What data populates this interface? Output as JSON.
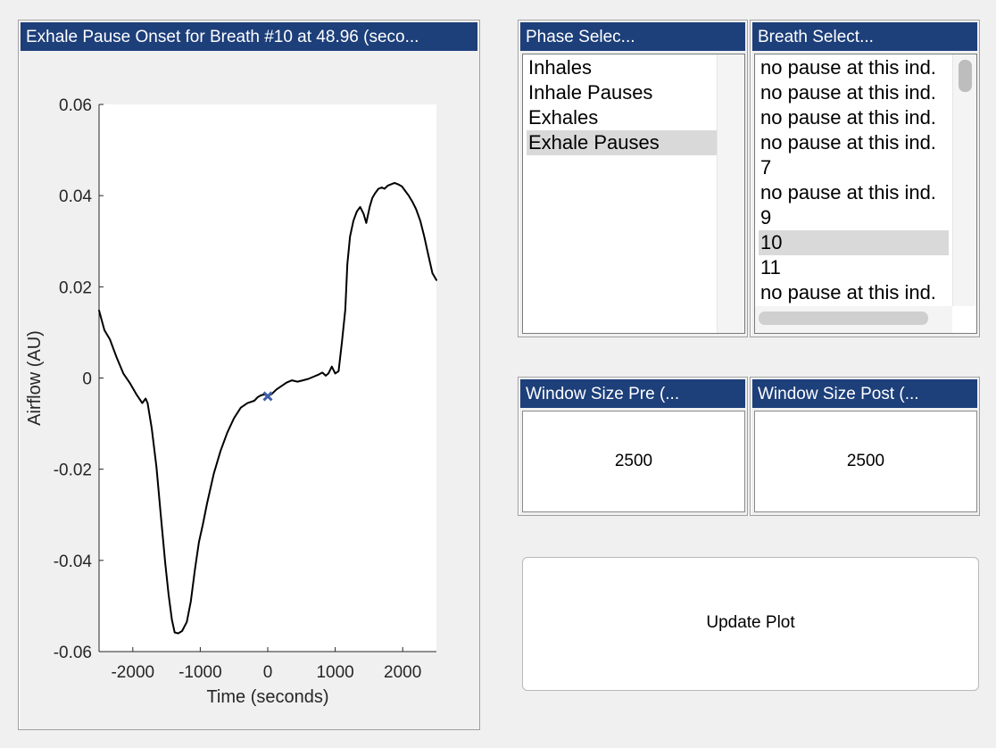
{
  "plot_panel": {
    "title": "Exhale Pause Onset for Breath #10 at 48.96 (seco..."
  },
  "phase_panel": {
    "title": "Phase Selec...",
    "items": [
      {
        "label": "Inhales",
        "selected": false
      },
      {
        "label": "Inhale Pauses",
        "selected": false
      },
      {
        "label": "Exhales",
        "selected": false
      },
      {
        "label": "Exhale Pauses",
        "selected": true
      }
    ]
  },
  "breath_panel": {
    "title": "Breath Select...",
    "items": [
      {
        "label": "no pause at this ind.",
        "selected": false
      },
      {
        "label": "no pause at this ind.",
        "selected": false
      },
      {
        "label": "no pause at this ind.",
        "selected": false
      },
      {
        "label": "no pause at this ind.",
        "selected": false
      },
      {
        "label": "7",
        "selected": false
      },
      {
        "label": "no pause at this ind.",
        "selected": false
      },
      {
        "label": "9",
        "selected": false
      },
      {
        "label": "10",
        "selected": true
      },
      {
        "label": "11",
        "selected": false
      },
      {
        "label": "no pause at this ind.",
        "selected": false
      }
    ]
  },
  "window_pre": {
    "title": "Window Size Pre (...",
    "value": "2500"
  },
  "window_post": {
    "title": "Window Size Post (...",
    "value": "2500"
  },
  "update_button": {
    "label": "Update Plot"
  },
  "colors": {
    "title_bar": "#1d3f7a",
    "selection": "#d9d9d9",
    "trace": "#000000",
    "marker": "#3f5fa8"
  },
  "chart_data": {
    "type": "line",
    "xlabel": "Time (seconds)",
    "ylabel": "Airflow (AU)",
    "xlim": [
      -2500,
      2500
    ],
    "ylim": [
      -0.06,
      0.06
    ],
    "xticks": [
      -2000,
      -1000,
      0,
      1000,
      2000
    ],
    "xtick_labels": [
      "-2000",
      "-1000",
      "0",
      "1000",
      "2000"
    ],
    "yticks": [
      0.06,
      0.04,
      0.02,
      0,
      -0.02,
      -0.04,
      -0.06
    ],
    "ytick_labels": [
      "0.06",
      "0.04",
      "0.02",
      "0",
      "-0.02",
      "-0.04",
      "-0.06"
    ],
    "grid": false,
    "series": [
      {
        "x": [
          -2500,
          -2420,
          -2340,
          -2240,
          -2140,
          -2040,
          -1950,
          -1860,
          -1810,
          -1780,
          -1720,
          -1650,
          -1580,
          -1520,
          -1470,
          -1420,
          -1380,
          -1330,
          -1270,
          -1200,
          -1140,
          -1080,
          -1020,
          -960,
          -900,
          -800,
          -700,
          -600,
          -500,
          -400,
          -300,
          -200,
          -150,
          -100,
          -50,
          0,
          60,
          130,
          200,
          280,
          360,
          440,
          520,
          600,
          680,
          760,
          810,
          860,
          900,
          950,
          1000,
          1050,
          1100,
          1150,
          1180,
          1220,
          1270,
          1320,
          1370,
          1420,
          1460,
          1510,
          1550,
          1590,
          1640,
          1690,
          1730,
          1780,
          1830,
          1880,
          1930,
          1990,
          2040,
          2090,
          2150,
          2200,
          2260,
          2320,
          2380,
          2440,
          2500
        ],
        "y": [
          0.0148,
          0.0105,
          0.0085,
          0.0045,
          0.001,
          -0.0012,
          -0.0035,
          -0.0055,
          -0.0045,
          -0.0055,
          -0.011,
          -0.0195,
          -0.031,
          -0.0405,
          -0.0475,
          -0.053,
          -0.0558,
          -0.056,
          -0.0555,
          -0.0535,
          -0.049,
          -0.042,
          -0.036,
          -0.032,
          -0.0275,
          -0.021,
          -0.016,
          -0.012,
          -0.0088,
          -0.0065,
          -0.0055,
          -0.005,
          -0.0042,
          -0.0038,
          -0.0036,
          -0.004,
          -0.0035,
          -0.0025,
          -0.0018,
          -0.001,
          -0.0005,
          -0.0008,
          -0.0005,
          -0.0002,
          0.0003,
          0.0008,
          0.0012,
          0.0005,
          0.001,
          0.0025,
          0.001,
          0.0015,
          0.008,
          0.015,
          0.025,
          0.031,
          0.0345,
          0.0365,
          0.0375,
          0.036,
          0.034,
          0.0375,
          0.0395,
          0.0405,
          0.0415,
          0.0418,
          0.0415,
          0.0422,
          0.0425,
          0.0428,
          0.0425,
          0.042,
          0.041,
          0.04,
          0.0385,
          0.037,
          0.0345,
          0.031,
          0.027,
          0.023,
          0.0215
        ]
      }
    ],
    "marker": {
      "x": 0,
      "y": -0.004,
      "symbol": "x"
    }
  }
}
